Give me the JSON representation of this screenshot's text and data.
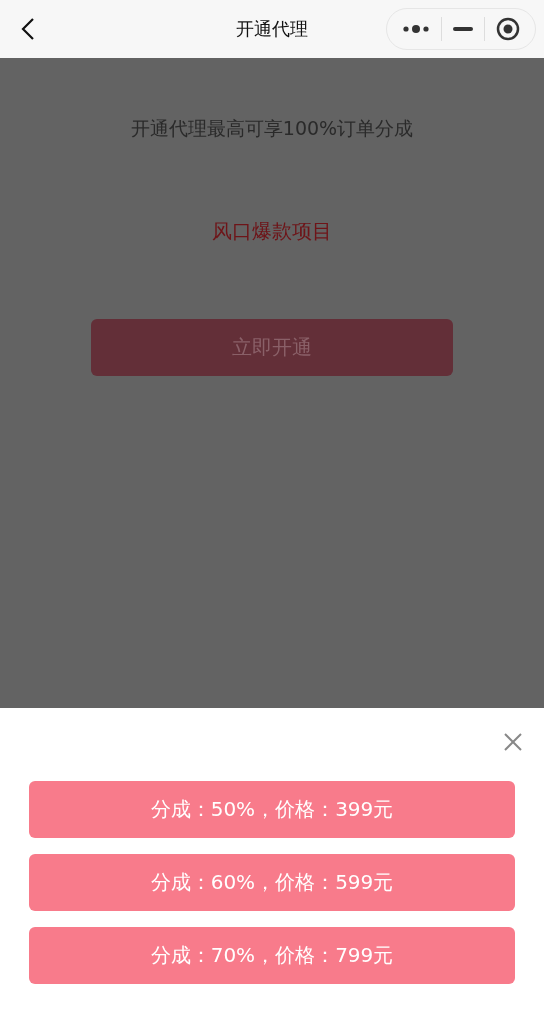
{
  "nav_bar": {
    "title": "开通代理"
  },
  "page": {
    "headline": "开通代理最高可享100%订单分成",
    "highlight": "风口爆款项目",
    "button": "立即开通"
  },
  "sheet": {
    "options": [
      {
        "label": "分成：50%，价格：399元"
      },
      {
        "label": "分成：60%，价格：599元"
      },
      {
        "label": "分成：70%，价格：799元"
      }
    ]
  }
}
